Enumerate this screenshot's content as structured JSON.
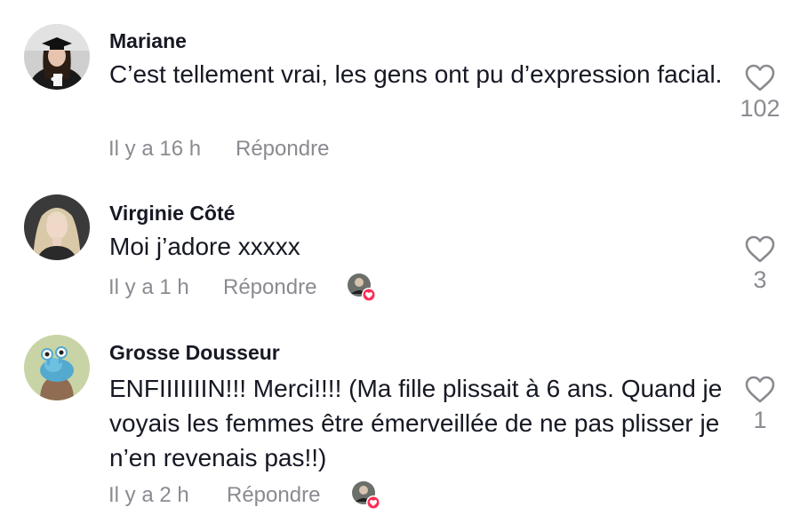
{
  "comments": [
    {
      "username": "Mariane",
      "text": "C’est tellement vrai, les gens ont pu d’expression facial.",
      "time": "Il y a 16 h",
      "reply_label": "Répondre",
      "likes": "102",
      "avatar": "graduate-avatar",
      "liked_by_creator": false
    },
    {
      "username": "Virginie Côté",
      "text": "Moi j’adore xxxxx",
      "time": "Il y a 1 h",
      "reply_label": "Répondre",
      "likes": "3",
      "avatar": "blonde-woman-avatar",
      "liked_by_creator": true
    },
    {
      "username": "Grosse Dousseur",
      "text": "ENFIIIIIIIN!!! Merci!!!! (Ma fille plissait à 6 ans. Quand je voyais les femmes être émerveillée de ne pas plisser je n’en revenais pas!!)",
      "time": "Il y a 2 h",
      "reply_label": "Répondre",
      "likes": "1",
      "avatar": "cartoon-creature-avatar",
      "liked_by_creator": true
    }
  ],
  "colors": {
    "primary_text": "#161823",
    "secondary_text": "#8a8b91",
    "like_badge": "#fe2c55"
  }
}
